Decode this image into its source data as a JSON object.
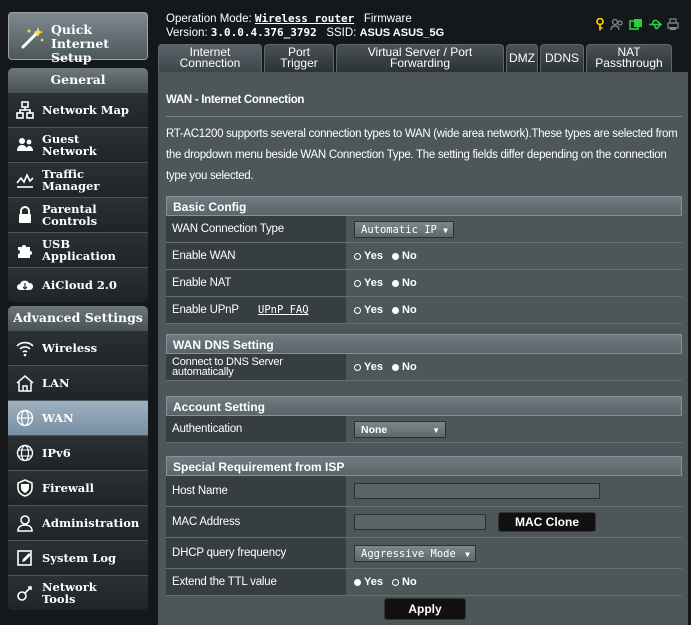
{
  "quick_internet": {
    "label": "Quick Internet Setup"
  },
  "sidebar": {
    "general_title": "General",
    "general_items": [
      {
        "label": "Network Map",
        "icon": "network-map-icon"
      },
      {
        "label": "Guest Network",
        "icon": "guest-network-icon"
      },
      {
        "label": "Traffic Manager",
        "icon": "traffic-manager-icon"
      },
      {
        "label": "Parental Controls",
        "icon": "lock-icon"
      },
      {
        "label": "USB Application",
        "icon": "puzzle-icon"
      },
      {
        "label": "AiCloud 2.0",
        "icon": "cloud-icon"
      }
    ],
    "advanced_title": "Advanced Settings",
    "advanced_items": [
      {
        "label": "Wireless",
        "icon": "wifi-icon"
      },
      {
        "label": "LAN",
        "icon": "home-icon"
      },
      {
        "label": "WAN",
        "icon": "globe-icon"
      },
      {
        "label": "IPv6",
        "icon": "globe-ipv6-icon"
      },
      {
        "label": "Firewall",
        "icon": "shield-icon"
      },
      {
        "label": "Administration",
        "icon": "user-icon"
      },
      {
        "label": "System Log",
        "icon": "log-icon"
      },
      {
        "label": "Network Tools",
        "icon": "tools-icon"
      }
    ],
    "selected": "WAN"
  },
  "header": {
    "op_mode_label": "Operation Mode:",
    "op_mode_value": "Wireless router",
    "firmware_label": "Firmware",
    "version_label": "Version:",
    "version_value": "3.0.0.4.376_3792",
    "ssid_label": "SSID:",
    "ssid_value": "ASUS ASUS_5G"
  },
  "tabs": [
    {
      "label": "Internet Connection"
    },
    {
      "label": "Port Trigger"
    },
    {
      "label": "Virtual Server / Port Forwarding"
    },
    {
      "label": "DMZ"
    },
    {
      "label": "DDNS"
    },
    {
      "label": "NAT Passthrough"
    }
  ],
  "main": {
    "title": "WAN - Internet Connection",
    "description": "RT-AC1200 supports several connection types to WAN (wide area network).These types are selected from the dropdown menu beside WAN Connection Type. The setting fields differ depending on the connection type you selected.",
    "basic": {
      "title": "Basic Config",
      "wan_type_label": "WAN Connection Type",
      "wan_type_value": "Automatic IP",
      "enable_wan_label": "Enable WAN",
      "enable_nat_label": "Enable NAT",
      "enable_upnp_label": "Enable UPnP",
      "upnp_faq": "UPnP FAQ"
    },
    "dns": {
      "title": "WAN DNS Setting",
      "connect_dns_label": "Connect to DNS Server automatically"
    },
    "account": {
      "title": "Account Setting",
      "auth_label": "Authentication",
      "auth_value": "None"
    },
    "isp": {
      "title": "Special Requirement from ISP",
      "host_label": "Host Name",
      "host_value": "",
      "mac_label": "MAC Address",
      "mac_value": "",
      "mac_clone": "MAC Clone",
      "dhcp_label": "DHCP query frequency",
      "dhcp_value": "Aggressive Mode",
      "ttl_label": "Extend the TTL value"
    },
    "yes": "Yes",
    "no": "No",
    "apply": "Apply"
  }
}
